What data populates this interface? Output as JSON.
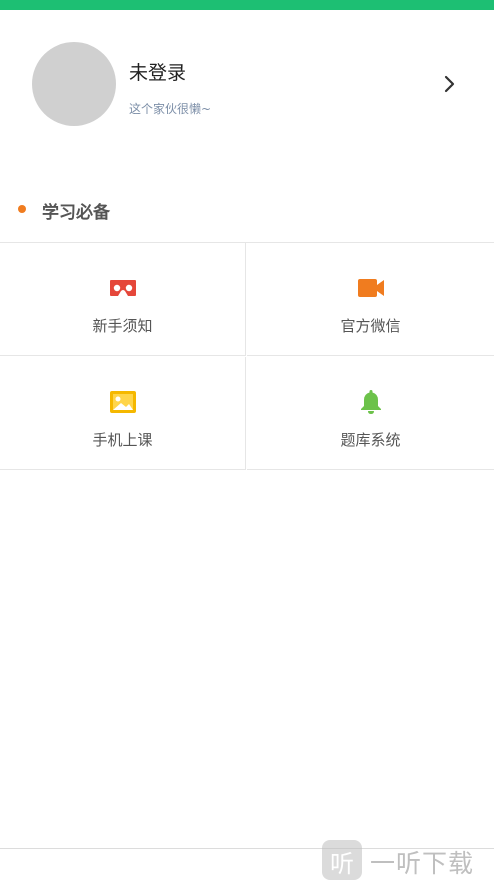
{
  "colors": {
    "top_bar": "#1dbf73",
    "section_dot": "#f07c1f",
    "icon_vr": "#e5473a",
    "icon_video": "#f07c1f",
    "icon_image": "#f5b800",
    "icon_bell": "#6cc24a"
  },
  "profile": {
    "name": "未登录",
    "subtitle": "这个家伙很懒~",
    "chevron_icon": "chevron-right-icon"
  },
  "section": {
    "title": "学习必备"
  },
  "grid": {
    "items": [
      {
        "label": "新手须知",
        "icon": "vr-glasses-icon"
      },
      {
        "label": "官方微信",
        "icon": "video-camera-icon"
      },
      {
        "label": "手机上课",
        "icon": "image-icon"
      },
      {
        "label": "题库系统",
        "icon": "bell-icon"
      }
    ]
  },
  "watermark": {
    "glyph": "听",
    "text": "一听下载"
  }
}
